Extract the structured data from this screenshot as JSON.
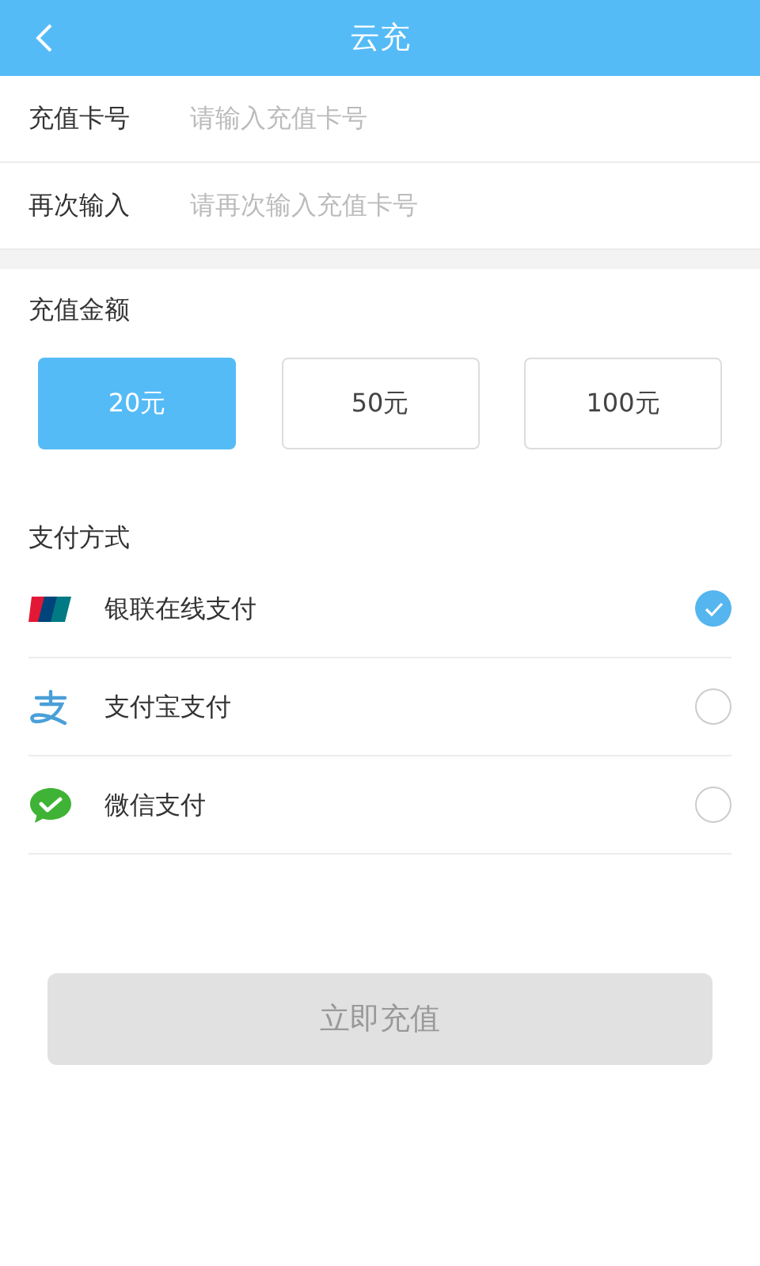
{
  "header": {
    "title": "云充"
  },
  "fields": [
    {
      "label": "充值卡号",
      "placeholder": "请输入充值卡号"
    },
    {
      "label": "再次输入",
      "placeholder": "请再次输入充值卡号"
    }
  ],
  "amount": {
    "title": "充值金额",
    "options": [
      {
        "label": "20元",
        "selected": true
      },
      {
        "label": "50元",
        "selected": false
      },
      {
        "label": "100元",
        "selected": false
      }
    ]
  },
  "payment": {
    "title": "支付方式",
    "methods": [
      {
        "kind": "unionpay",
        "label": "银联在线支付",
        "selected": true
      },
      {
        "kind": "alipay",
        "label": "支付宝支付",
        "selected": false
      },
      {
        "kind": "wechat",
        "label": "微信支付",
        "selected": false
      }
    ]
  },
  "submit": {
    "label": "立即充值",
    "disabled": true
  }
}
